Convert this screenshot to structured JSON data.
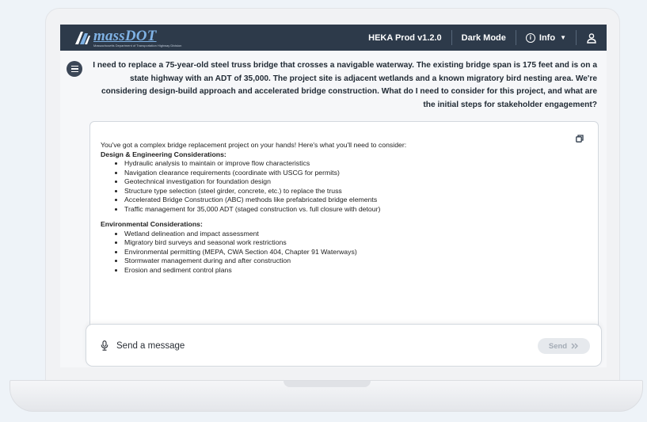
{
  "app": {
    "logo_text": "massDOT",
    "logo_subtext": "Massachusetts Department of Transportation Highway Division",
    "version_label": "HEKA Prod v1.2.0",
    "dark_mode_label": "Dark Mode",
    "info_label": "Info",
    "logo_icon": "massdot-logo-icon",
    "user_icon": "user-icon",
    "info_icon": "info-icon",
    "accent_color": "#2d3a4a"
  },
  "conversation": {
    "user_message": "I need to replace a 75-year-old steel truss bridge that crosses a navigable waterway. The existing bridge span is 175 feet and is on a state highway with an ADT of 35,000.  The project site is adjacent  wetlands and a known migratory bird nesting area. We're considering design-build approach and accelerated bridge construction. What do I need to consider for this project, and what are the initial steps for stakeholder engagement?",
    "response": {
      "intro": "You've got a complex bridge replacement project on your hands! Here's what you'll need to consider:",
      "sections": [
        {
          "title": "Design & Engineering Considerations:",
          "items": [
            "Hydraulic analysis to maintain or improve flow characteristics",
            "Navigation clearance requirements (coordinate with USCG for permits)",
            "Geotechnical investigation for foundation design",
            "Structure type selection (steel girder, concrete, etc.) to replace the truss",
            "Accelerated Bridge Construction (ABC) methods like prefabricated bridge elements",
            "Traffic management for 35,000 ADT (staged construction vs. full closure with detour)"
          ]
        },
        {
          "title": "Environmental Considerations:",
          "items": [
            "Wetland delineation and impact assessment",
            "Migratory bird surveys and seasonal work restrictions",
            "Environmental permitting (MEPA, CWA Section 404, Chapter 91 Waterways)",
            "Stormwater management during and after construction",
            "Erosion and sediment control plans"
          ]
        }
      ]
    }
  },
  "composer": {
    "placeholder": "Send a message",
    "send_label": "Send",
    "send_icon": "double-chevron-right-icon",
    "mic_icon": "microphone-icon"
  }
}
